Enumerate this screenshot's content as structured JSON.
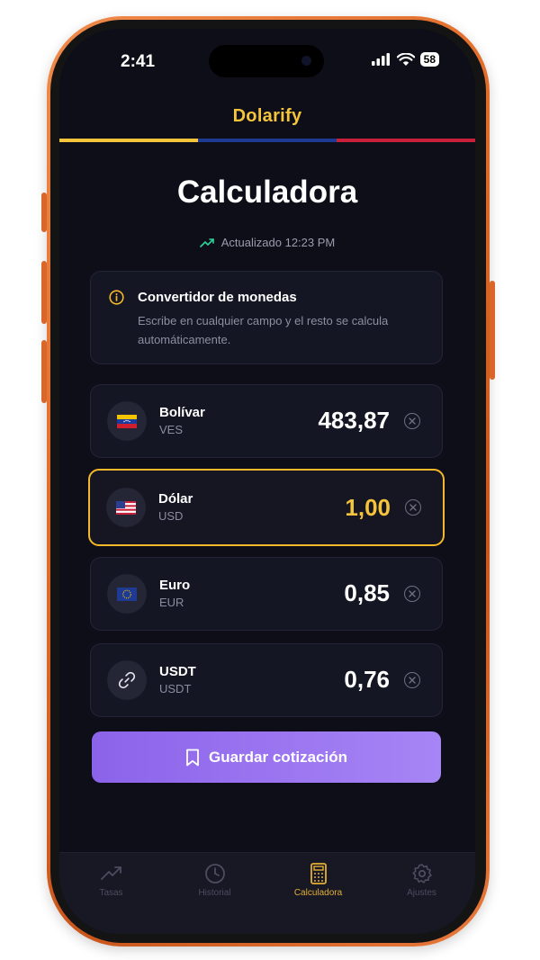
{
  "status_bar": {
    "time": "2:41",
    "battery": "58"
  },
  "app": {
    "title": "Dolarify"
  },
  "page": {
    "title": "Calculadora",
    "updated": "Actualizado 12:23 PM"
  },
  "info": {
    "title": "Convertidor de monedas",
    "description": "Escribe en cualquier campo y el resto se calcula automáticamente."
  },
  "currencies": [
    {
      "name": "Bolívar",
      "code": "VES",
      "value": "483,87",
      "icon": "venezuela-flag-icon"
    },
    {
      "name": "Dólar",
      "code": "USD",
      "value": "1,00",
      "icon": "usa-flag-icon",
      "active": true
    },
    {
      "name": "Euro",
      "code": "EUR",
      "value": "0,85",
      "icon": "eu-flag-icon"
    },
    {
      "name": "USDT",
      "code": "USDT",
      "value": "0,76",
      "icon": "link-icon"
    }
  ],
  "save_button": {
    "label": "Guardar cotización"
  },
  "tabs": [
    {
      "label": "Tasas",
      "icon": "trending-up-icon"
    },
    {
      "label": "Historial",
      "icon": "clock-icon"
    },
    {
      "label": "Calculadora",
      "icon": "calculator-icon",
      "active": true
    },
    {
      "label": "Ajustes",
      "icon": "gear-icon"
    }
  ],
  "colors": {
    "accent": "#f5c43a",
    "active_border": "#f5b82a",
    "button": "#9a74f0",
    "background": "#0d0e18",
    "card": "#151623",
    "flag_yellow": "#f5c43a",
    "flag_blue": "#1f3a93",
    "flag_red": "#c8203a"
  }
}
